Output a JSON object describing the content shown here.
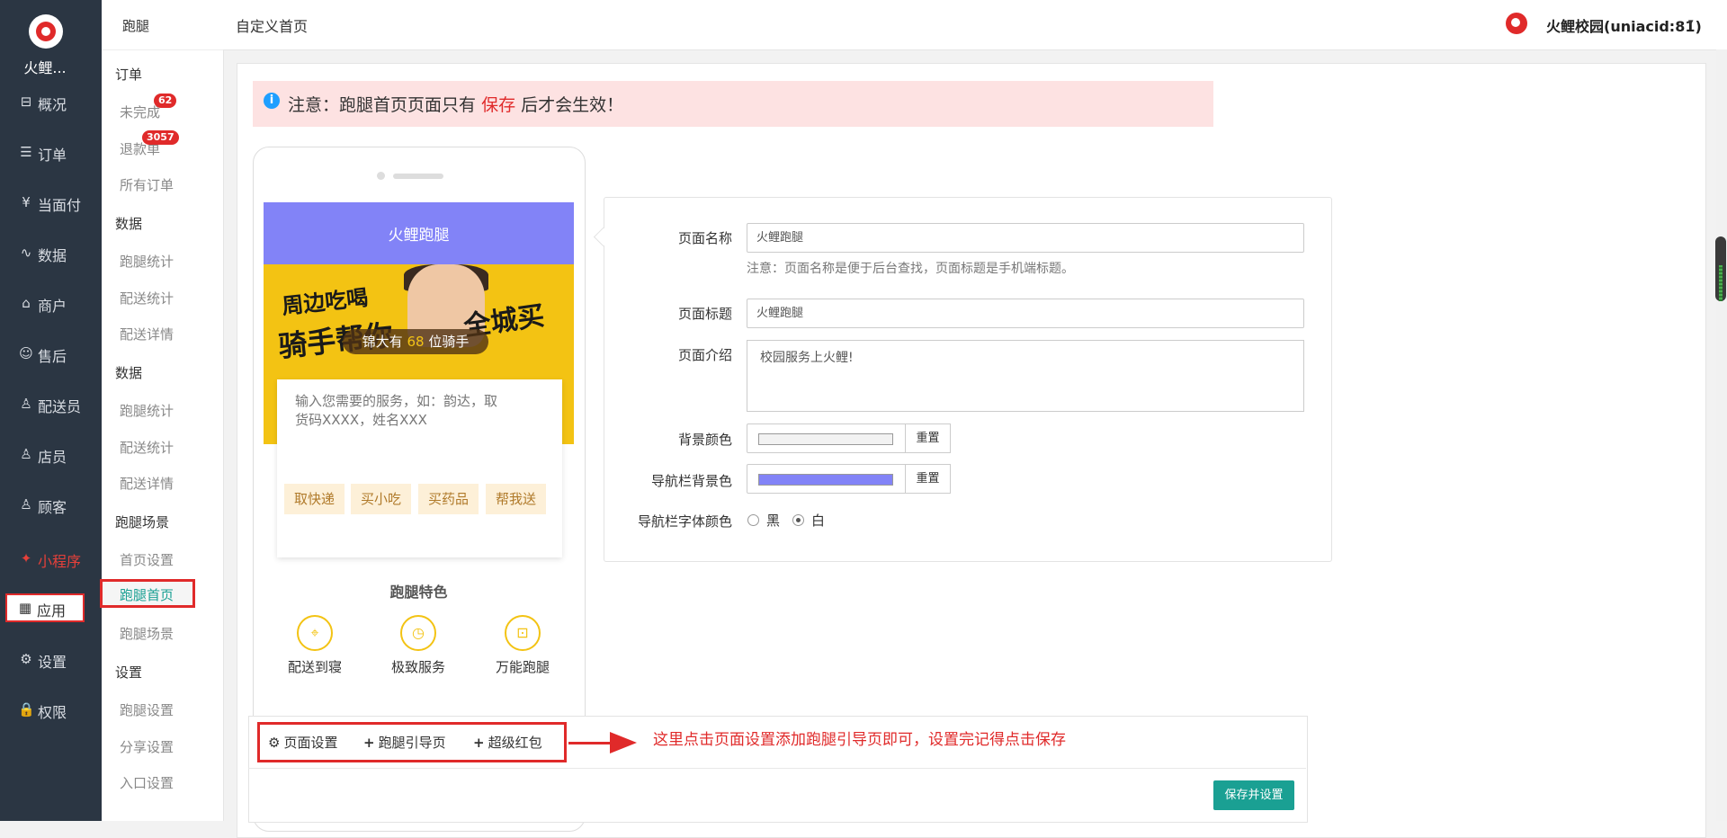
{
  "sidebar": {
    "brand": "火鲤...",
    "items": [
      {
        "label": "概况",
        "icon": "dashboard-icon",
        "glyph": "⊟"
      },
      {
        "label": "订单",
        "icon": "order-list-icon",
        "glyph": "☰"
      },
      {
        "label": "当面付",
        "icon": "yen-icon",
        "glyph": "¥"
      },
      {
        "label": "数据",
        "icon": "chart-icon",
        "glyph": "∿"
      },
      {
        "label": "商户",
        "icon": "store-icon",
        "glyph": "⌂"
      },
      {
        "label": "售后",
        "icon": "support-icon",
        "glyph": "☺"
      },
      {
        "label": "配送员",
        "icon": "user-icon",
        "glyph": "♙"
      },
      {
        "label": "店员",
        "icon": "clerk-icon",
        "glyph": "♙"
      },
      {
        "label": "顾客",
        "icon": "customer-icon",
        "glyph": "♙"
      },
      {
        "label": "小程序",
        "icon": "miniprogram-icon",
        "glyph": "✦"
      },
      {
        "label": "应用",
        "icon": "apps-icon",
        "glyph": "▦"
      },
      {
        "label": "设置",
        "icon": "gear-icon",
        "glyph": "⚙"
      },
      {
        "label": "权限",
        "icon": "lock-icon",
        "glyph": "🔒"
      }
    ]
  },
  "subnav": {
    "title": "跑腿",
    "order_head": "订单",
    "unfinished": "未完成",
    "unfinished_badge": "62",
    "refund": "退款单",
    "refund_badge": "3057",
    "all_orders": "所有订单",
    "data_head1": "数据",
    "data1": [
      "跑腿统计",
      "配送统计",
      "配送详情"
    ],
    "data_head2": "数据",
    "data2": [
      "跑腿统计",
      "配送统计",
      "配送详情"
    ],
    "scene_head": "跑腿场景",
    "scene": [
      "首页设置",
      "跑腿首页",
      "跑腿场景"
    ],
    "settings_head": "设置",
    "settings": [
      "跑腿设置",
      "分享设置",
      "入口设置"
    ]
  },
  "header": {
    "page_title": "自定义首页",
    "user": "火鲤校园(uniacid:81)",
    "caret": "▾"
  },
  "notice": {
    "icon": "i",
    "prefix": "注意：跑腿首页页面只有",
    "highlight": "保存",
    "suffix": "后才会生效！"
  },
  "preview": {
    "nav_title": "火鲤跑腿",
    "banner_line1": "周边吃喝",
    "banner_line2": "骑手帮你",
    "banner_line3": "全城买",
    "rider_prefix": "锦大有",
    "rider_count": "68",
    "rider_suffix": "位骑手",
    "service_placeholder": "输入您需要的服务，如：韵达，取货码XXXX，姓名XXX",
    "services": [
      "取快递",
      "买小吃",
      "买药品",
      "帮我送"
    ],
    "features_title": "跑腿特色",
    "features": [
      {
        "label": "配送到寝",
        "icon": "location-pin-icon",
        "glyph": "⌖"
      },
      {
        "label": "极致服务",
        "icon": "clock-icon",
        "glyph": "◷"
      },
      {
        "label": "万能跑腿",
        "icon": "bag-icon",
        "glyph": "⊡"
      }
    ]
  },
  "form": {
    "page_name_label": "页面名称",
    "page_name_value": "火鲤跑腿",
    "page_name_help": "注意：页面名称是便于后台查找，页面标题是手机端标题。",
    "page_title_label": "页面标题",
    "page_title_value": "火鲤跑腿",
    "intro_label": "页面介绍",
    "intro_value": "校园服务上火鲤!",
    "bg_color_label": "背景颜色",
    "bg_color": "#f2f2f2",
    "nav_bg_label": "导航栏背景色",
    "nav_bg_color": "#8283f7",
    "reset_label": "重置",
    "nav_font_label": "导航栏字体颜色",
    "font_options": [
      "黑",
      "白"
    ],
    "font_selected": "白"
  },
  "toolbar": {
    "page_settings": "页面设置",
    "guide_page": "跑腿引导页",
    "red_packet": "超级红包",
    "hint": "这里点击页面设置添加跑腿引导页即可，设置完记得点击保存",
    "save": "保存并设置"
  },
  "colors": {
    "sidebar_bg": "#2b3643",
    "accent": "#1aa093",
    "alert": "#e02a2a",
    "nav_purple": "#8283f7",
    "banner_yellow": "#f3c313"
  }
}
